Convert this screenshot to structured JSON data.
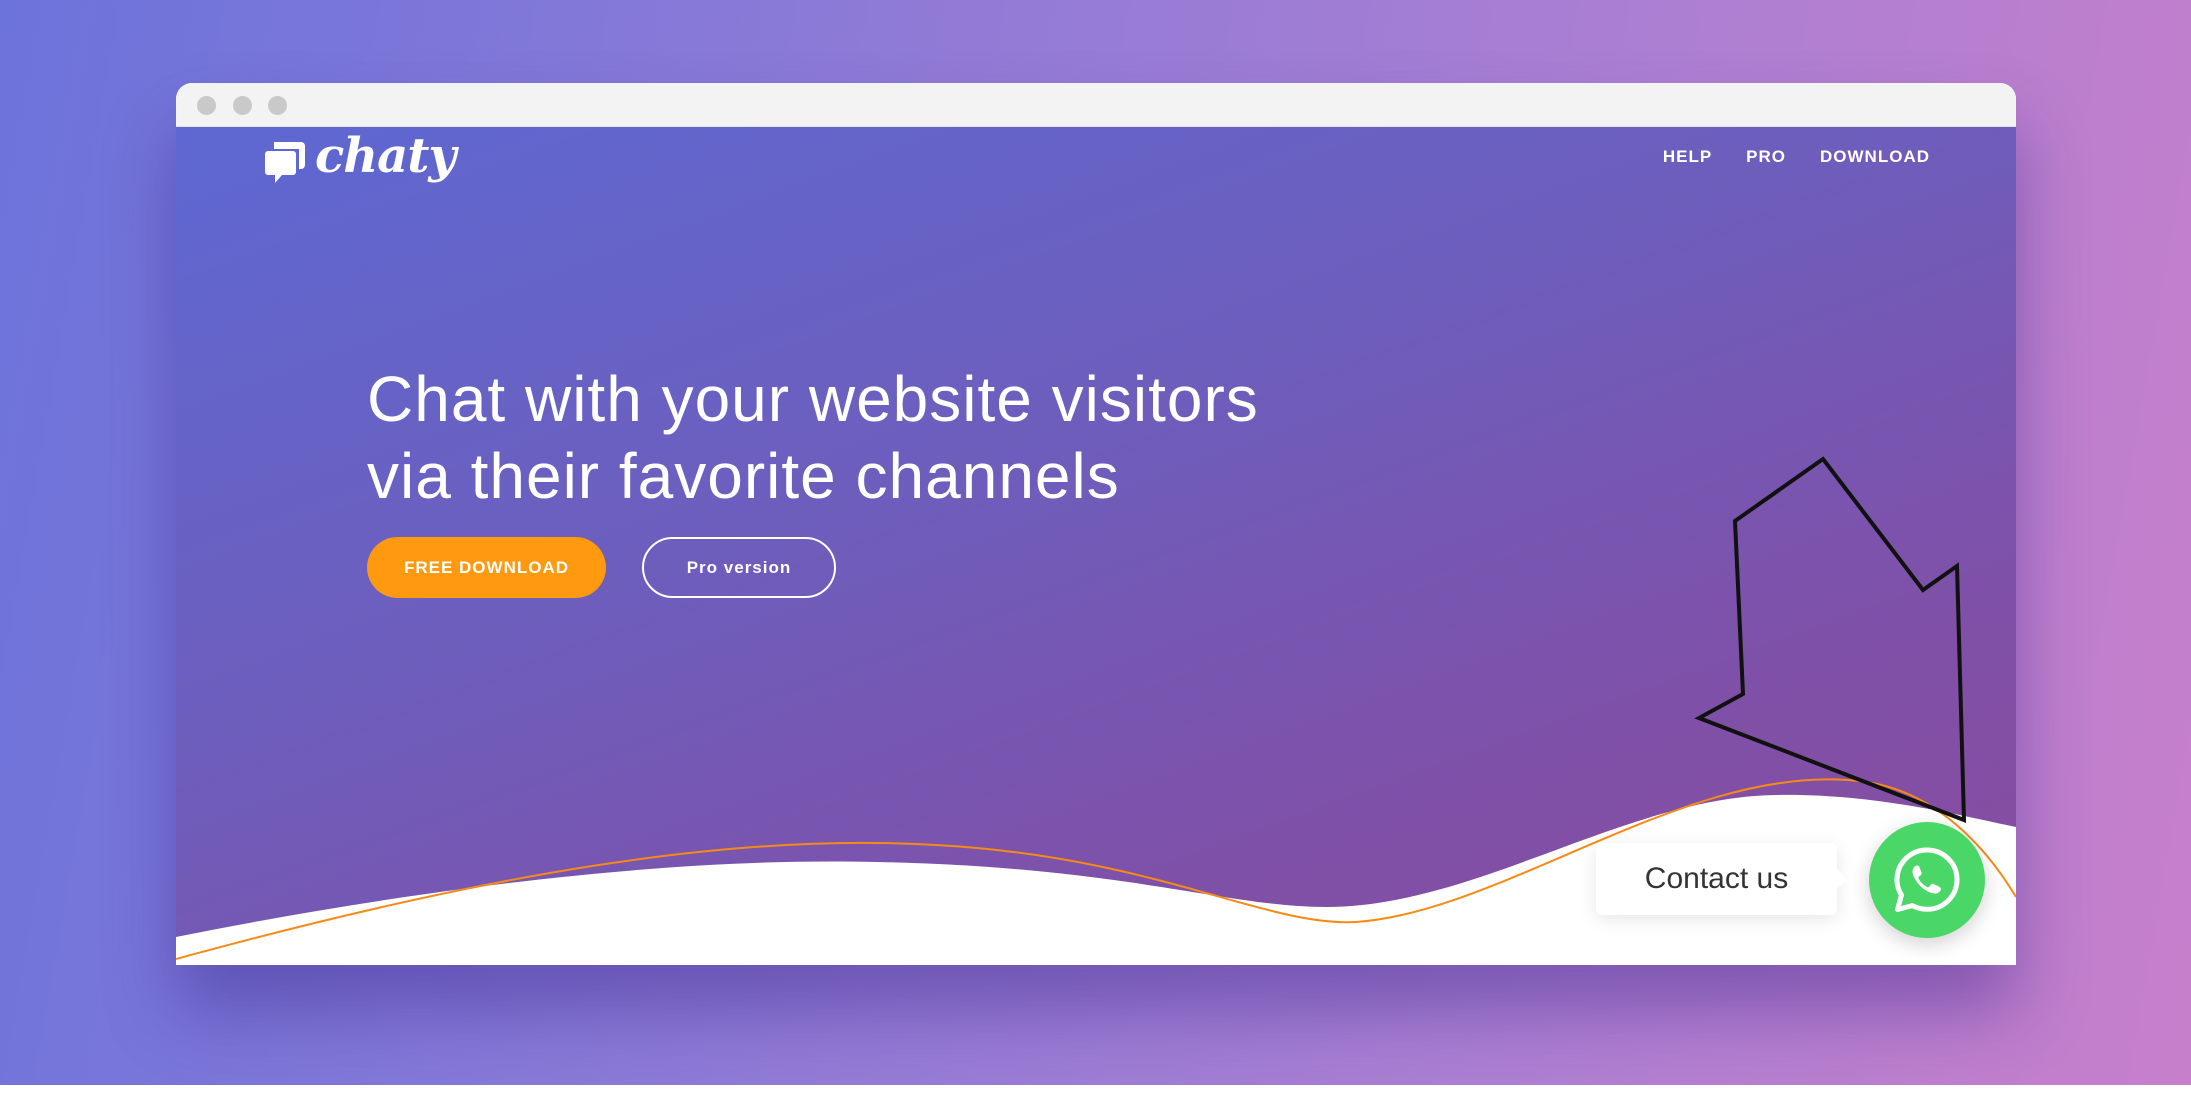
{
  "site": {
    "logo_text": "chaty",
    "nav": {
      "help": "HELP",
      "pro": "PRO",
      "download": "DOWNLOAD"
    },
    "headline": {
      "line1": "Chat with your website visitors",
      "line2": "via their favorite channels"
    },
    "buttons": {
      "free_download": "FREE DOWNLOAD",
      "pro_version": "Pro version"
    },
    "widget": {
      "tooltip": "Contact us",
      "icon": "whatsapp-icon"
    }
  },
  "colors": {
    "primary_button": "#ff9a10",
    "whatsapp_green": "#4ad767",
    "wave_line": "#f58b16"
  }
}
